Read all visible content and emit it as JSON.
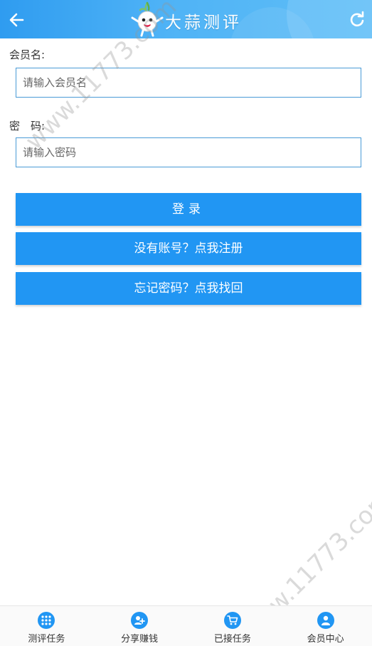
{
  "header": {
    "title": "大蒜测评",
    "back_icon": "arrow-left-icon",
    "refresh_icon": "refresh-icon",
    "logo": "garlic-mascot-logo"
  },
  "form": {
    "username_label": "会员名:",
    "username_placeholder": "请输入会员名",
    "username_value": "",
    "password_label": "密　码:",
    "password_placeholder": "请输入密码",
    "password_value": ""
  },
  "buttons": {
    "login": "登录",
    "register": "没有账号？点我注册",
    "forgot": "忘记密码？点我找回"
  },
  "watermark": {
    "text": "www.11773.com"
  },
  "bottom_nav": {
    "items": [
      {
        "label": "测评任务",
        "icon": "grid-icon"
      },
      {
        "label": "分享赚钱",
        "icon": "add-user-icon"
      },
      {
        "label": "已接任务",
        "icon": "cart-icon"
      },
      {
        "label": "会员中心",
        "icon": "user-icon"
      }
    ]
  },
  "colors": {
    "primary": "#2196f3",
    "header_gradient_start": "#2f9cf0",
    "header_gradient_end": "#5fbef7",
    "input_border": "#4a9bd6"
  }
}
